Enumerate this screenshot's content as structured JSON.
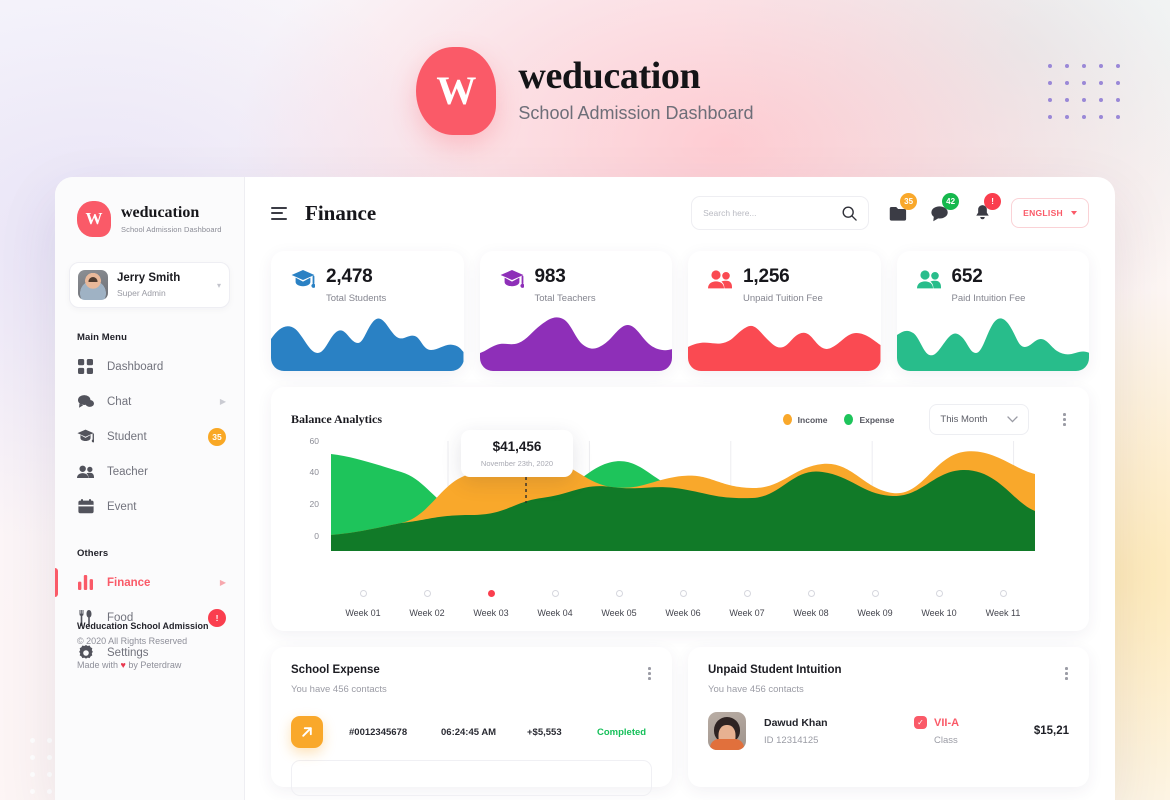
{
  "brand": {
    "mark": "W",
    "name": "weducation",
    "tagline": "School Admission Dashboard"
  },
  "sidebar": {
    "brand_name": "weducation",
    "brand_tagline": "School Admission Dashboard",
    "profile": {
      "name": "Jerry Smith",
      "role": "Super Admin",
      "caret": "chevron-down-icon"
    },
    "sections": [
      {
        "title": "Main Menu",
        "items": [
          {
            "label": "Dashboard",
            "icon": "grid-icon",
            "badge": null,
            "arrow": false,
            "active": false
          },
          {
            "label": "Chat",
            "icon": "chat-bubble-icon",
            "badge": null,
            "arrow": true,
            "active": false
          },
          {
            "label": "Student",
            "icon": "graduation-cap-icon",
            "badge": "35",
            "badge_color": "orange",
            "arrow": false,
            "active": false
          },
          {
            "label": "Teacher",
            "icon": "people-icon",
            "badge": null,
            "arrow": false,
            "active": false
          },
          {
            "label": "Event",
            "icon": "calendar-icon",
            "badge": null,
            "arrow": false,
            "active": false
          }
        ]
      },
      {
        "title": "Others",
        "items": [
          {
            "label": "Finance",
            "icon": "bar-chart-icon",
            "badge": null,
            "arrow": true,
            "active": true
          },
          {
            "label": "Food",
            "icon": "cutlery-icon",
            "badge": "!",
            "badge_color": "red",
            "arrow": false,
            "active": false
          },
          {
            "label": "Settings",
            "icon": "gear-icon",
            "badge": null,
            "arrow": false,
            "active": false
          }
        ]
      }
    ],
    "footer": {
      "line1": "Weducation School Admission",
      "line2": "© 2020 All Rights Reserved",
      "line3_pre": "Made with ",
      "line3_heart": "♥",
      "line3_post": " by Peterdraw"
    }
  },
  "topbar": {
    "menu_icon": "hamburger-icon",
    "title": "Finance",
    "search": {
      "placeholder": "Search here...",
      "value": "",
      "icon": "search-icon"
    },
    "notifications": [
      {
        "icon": "folder-icon",
        "count": "35",
        "color": "orange"
      },
      {
        "icon": "message-icon",
        "count": "42",
        "color": "green"
      },
      {
        "icon": "bell-icon",
        "count": "!",
        "color": "red"
      }
    ],
    "language": {
      "label": "ENGLISH",
      "icon": "chevron-down-icon"
    }
  },
  "stats": [
    {
      "value": "2,478",
      "label": "Total Students",
      "icon": "graduation-cap-icon",
      "color": "#2a81c4"
    },
    {
      "value": "983",
      "label": "Total Teachers",
      "icon": "graduation-cap-icon",
      "color": "#8e2fb8"
    },
    {
      "value": "1,256",
      "label": "Unpaid Tuition Fee",
      "icon": "people-icon",
      "color": "#fa4a52"
    },
    {
      "value": "652",
      "label": "Paid Intuition Fee",
      "icon": "people-icon",
      "color": "#28bd8b"
    }
  ],
  "analytics": {
    "title": "Balance Analytics",
    "legend": [
      {
        "label": "Income",
        "color": "#f9a82b"
      },
      {
        "label": "Expense",
        "color": "#1ec45b"
      }
    ],
    "range_select": {
      "value": "This Month",
      "icon": "chevron-down-icon"
    },
    "menu_icon": "kebab-menu-icon",
    "tooltip": {
      "value": "$41,456",
      "date": "November 23th, 2020"
    },
    "active_week_index": 2
  },
  "chart_data": {
    "type": "area",
    "title": "Balance Analytics",
    "xlabel": "",
    "ylabel": "",
    "ylim": [
      0,
      70
    ],
    "yticks": [
      0,
      20,
      40,
      60
    ],
    "grid": true,
    "legend_position": "top-right",
    "categories": [
      "Week 01",
      "Week 02",
      "Week 03",
      "Week 04",
      "Week 05",
      "Week 06",
      "Week 07",
      "Week 08",
      "Week 09",
      "Week 10",
      "Week 11"
    ],
    "series": [
      {
        "name": "Expense",
        "color": "#1ec45b",
        "values": [
          62,
          52,
          22,
          30,
          52,
          34,
          31,
          44,
          32,
          44,
          22
        ]
      },
      {
        "name": "Income",
        "color": "#f9a82b",
        "values": [
          10,
          18,
          45,
          52,
          36,
          41,
          36,
          52,
          42,
          64,
          49
        ]
      }
    ],
    "annotations": [
      {
        "text": "$41,456",
        "subtext": "November 23th, 2020",
        "series": "Income",
        "x": "Week 03",
        "y": 52
      }
    ]
  },
  "school_expense": {
    "title": "School Expense",
    "subtitle": "You have 456 contacts",
    "menu_icon": "kebab-menu-icon",
    "columns": [
      "icon",
      "id",
      "time",
      "amount",
      "status"
    ],
    "rows": [
      {
        "icon": "arrow-up-right-icon",
        "id": "#0012345678",
        "time": "06:24:45 AM",
        "amount": "+$5,553",
        "status": "Completed"
      }
    ]
  },
  "unpaid_student": {
    "title": "Unpaid Student Intuition",
    "subtitle": "You have 456 contacts",
    "menu_icon": "kebab-menu-icon",
    "rows": [
      {
        "avatar": "student-avatar",
        "name": "Dawud Khan",
        "id": "ID 12314125",
        "class_value": "VII-A",
        "class_label": "Class",
        "class_icon": "check-badge-icon",
        "amount": "$15,21"
      }
    ]
  }
}
